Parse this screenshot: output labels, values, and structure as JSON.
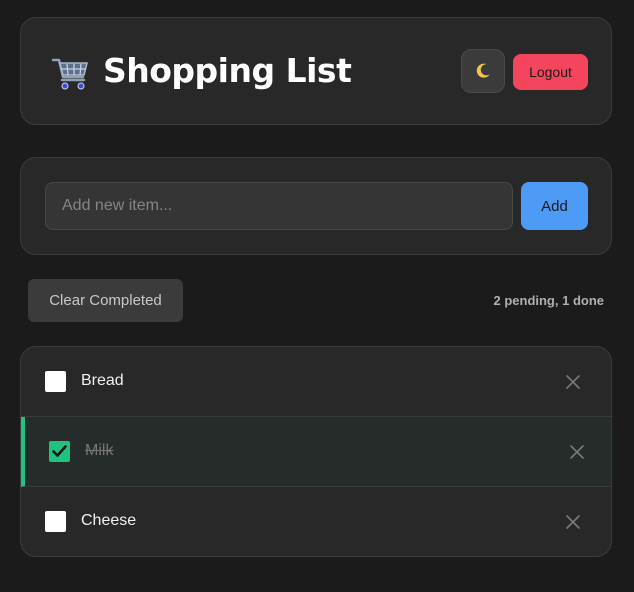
{
  "header": {
    "icon": "shopping-cart-icon",
    "title": "Shopping List",
    "theme_toggle_icon": "moon-icon",
    "logout_label": "Logout"
  },
  "add_item": {
    "placeholder": "Add new item...",
    "value": "",
    "button_label": "Add"
  },
  "toolbar": {
    "clear_label": "Clear Completed",
    "status": "2 pending, 1 done"
  },
  "items": [
    {
      "name": "Bread",
      "completed": false
    },
    {
      "name": "Milk",
      "completed": true
    },
    {
      "name": "Cheese",
      "completed": false
    }
  ],
  "colors": {
    "background": "#1b1b1b",
    "card": "#282828",
    "accent_blue": "#4d9bf5",
    "logout_red": "#f5455c",
    "done_green": "#20c27f"
  }
}
